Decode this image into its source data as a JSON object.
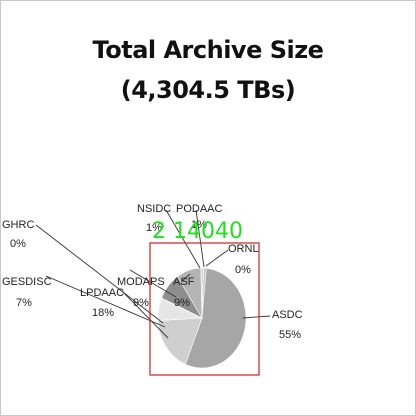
{
  "chart_data": {
    "type": "pie",
    "title": "Total Archive Size",
    "subtitle": "(4,304.5 TBs)",
    "slices": [
      {
        "label": "ASDC",
        "pct_label": "55%",
        "value": 55,
        "color": "#a6a6a6"
      },
      {
        "label": "LPDAAC",
        "pct_label": "18%",
        "value": 18,
        "color": "#cfcfcf"
      },
      {
        "label": "GESDISC",
        "pct_label": "7%",
        "value": 7,
        "color": "#e6e6e6"
      },
      {
        "label": "GHRC",
        "pct_label": "0%",
        "value": 0,
        "color": "#bdbdbd"
      },
      {
        "label": "MODAPS",
        "pct_label": "9%",
        "value": 9,
        "color": "#8e8e8e"
      },
      {
        "label": "ASF",
        "pct_label": "9%",
        "value": 9,
        "color": "#b4b4b4"
      },
      {
        "label": "NSIDC",
        "pct_label": "1%",
        "value": 1,
        "color": "#d8d8d8"
      },
      {
        "label": "PODAAC",
        "pct_label": "1%",
        "value": 1,
        "color": "#c4c4c4"
      },
      {
        "label": "ORNL",
        "pct_label": "0%",
        "value": 0,
        "color": "#9a9a9a"
      }
    ]
  },
  "overlay": {
    "text": "2 14040",
    "box_color": "#cc2222",
    "text_color": "#22dd22"
  }
}
